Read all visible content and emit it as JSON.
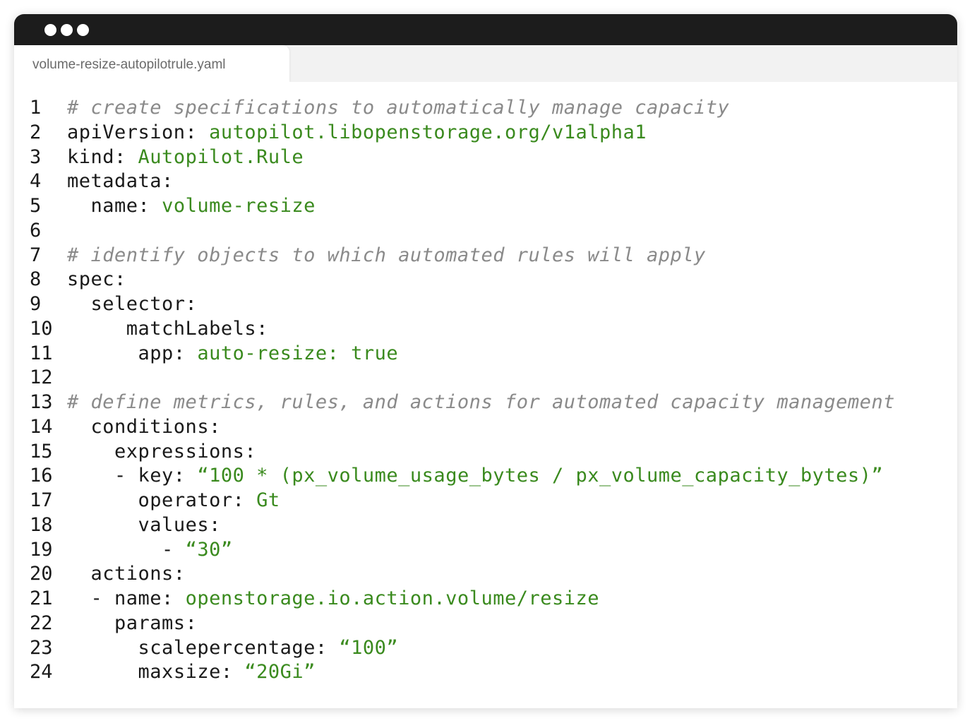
{
  "window": {
    "controls": [
      "window-dot",
      "window-dot",
      "window-dot"
    ]
  },
  "tab": {
    "filename": "volume-resize-autopilotrule.yaml"
  },
  "colors": {
    "titlebar": "#1c1c1c",
    "key_text": "#1a1a1a",
    "value_text": "#3a8a1e",
    "comment_text": "#8a8a8a"
  },
  "code_lines": [
    {
      "n": "1",
      "indent": "",
      "segs": [
        {
          "t": "# create specifications to automatically manage capacity",
          "c": "c"
        }
      ]
    },
    {
      "n": "2",
      "indent": "",
      "segs": [
        {
          "t": "apiVersion: ",
          "c": "k"
        },
        {
          "t": "autopilot.libopenstorage.org/v1alpha1",
          "c": "s"
        }
      ]
    },
    {
      "n": "3",
      "indent": "",
      "segs": [
        {
          "t": "kind: ",
          "c": "k"
        },
        {
          "t": "Autopilot.Rule",
          "c": "s"
        }
      ]
    },
    {
      "n": "4",
      "indent": "",
      "segs": [
        {
          "t": "metadata:",
          "c": "k"
        }
      ]
    },
    {
      "n": "5",
      "indent": "  ",
      "segs": [
        {
          "t": "name: ",
          "c": "k"
        },
        {
          "t": "volume-resize",
          "c": "s"
        }
      ]
    },
    {
      "n": "6",
      "indent": "",
      "segs": []
    },
    {
      "n": "7",
      "indent": "",
      "segs": [
        {
          "t": "# identify objects to which automated rules will apply",
          "c": "c"
        }
      ]
    },
    {
      "n": "8",
      "indent": "",
      "segs": [
        {
          "t": "spec:",
          "c": "k"
        }
      ]
    },
    {
      "n": "9",
      "indent": "  ",
      "segs": [
        {
          "t": "selector:",
          "c": "k"
        }
      ]
    },
    {
      "n": "10",
      "indent": "     ",
      "segs": [
        {
          "t": "matchLabels:",
          "c": "k"
        }
      ]
    },
    {
      "n": "11",
      "indent": "      ",
      "segs": [
        {
          "t": "app: ",
          "c": "k"
        },
        {
          "t": "auto-resize: true",
          "c": "s"
        }
      ]
    },
    {
      "n": "12",
      "indent": "",
      "segs": []
    },
    {
      "n": "13",
      "indent": "",
      "segs": [
        {
          "t": "# define metrics, rules, and actions for automated capacity management",
          "c": "c"
        }
      ]
    },
    {
      "n": "14",
      "indent": "  ",
      "segs": [
        {
          "t": "conditions:",
          "c": "k"
        }
      ]
    },
    {
      "n": "15",
      "indent": "    ",
      "segs": [
        {
          "t": "expressions:",
          "c": "k"
        }
      ]
    },
    {
      "n": "16",
      "indent": "    ",
      "segs": [
        {
          "t": "- key: ",
          "c": "k"
        },
        {
          "t": "“100 * (px_volume_usage_bytes / px_volume_capacity_bytes)”",
          "c": "s"
        }
      ]
    },
    {
      "n": "17",
      "indent": "      ",
      "segs": [
        {
          "t": "operator: ",
          "c": "k"
        },
        {
          "t": "Gt",
          "c": "s"
        }
      ]
    },
    {
      "n": "18",
      "indent": "      ",
      "segs": [
        {
          "t": "values:",
          "c": "k"
        }
      ]
    },
    {
      "n": "19",
      "indent": "        ",
      "segs": [
        {
          "t": "- ",
          "c": "k"
        },
        {
          "t": "“30”",
          "c": "s"
        }
      ]
    },
    {
      "n": "20",
      "indent": "  ",
      "segs": [
        {
          "t": "actions:",
          "c": "k"
        }
      ]
    },
    {
      "n": "21",
      "indent": "  ",
      "segs": [
        {
          "t": "- name: ",
          "c": "k"
        },
        {
          "t": "openstorage.io.action.volume/resize",
          "c": "s"
        }
      ]
    },
    {
      "n": "22",
      "indent": "    ",
      "segs": [
        {
          "t": "params:",
          "c": "k"
        }
      ]
    },
    {
      "n": "23",
      "indent": "      ",
      "segs": [
        {
          "t": "scalepercentage: ",
          "c": "k"
        },
        {
          "t": "“100”",
          "c": "s"
        }
      ]
    },
    {
      "n": "24",
      "indent": "      ",
      "segs": [
        {
          "t": "maxsize: ",
          "c": "k"
        },
        {
          "t": "“20Gi”",
          "c": "s"
        }
      ]
    }
  ]
}
